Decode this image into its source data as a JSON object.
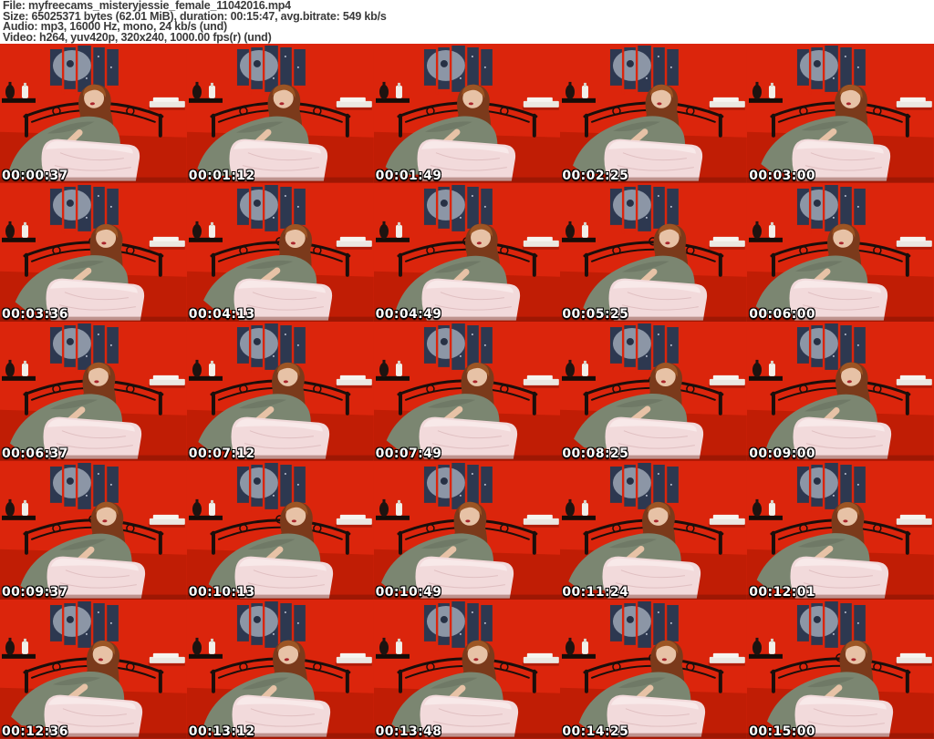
{
  "header": {
    "lines": [
      "File: myfreecams_misteryjessie_female_11042016.mp4",
      "Size: 65025371 bytes (62.01 MiB), duration: 00:15:47, avg.bitrate: 549 kb/s",
      "Audio: mp3, 16000 Hz, mono, 24 kb/s (und)",
      "Video: h264, yuv420p, 320x240, 1000.00 fps(r) (und)"
    ]
  },
  "grid": {
    "rows": 5,
    "cols": 5,
    "timestamps": [
      "00:00:37",
      "00:01:12",
      "00:01:49",
      "00:02:25",
      "00:03:00",
      "00:03:36",
      "00:04:13",
      "00:04:49",
      "00:05:25",
      "00:06:00",
      "00:06:37",
      "00:07:12",
      "00:07:49",
      "00:08:25",
      "00:09:00",
      "00:09:37",
      "00:10:13",
      "00:10:49",
      "00:11:24",
      "00:12:01",
      "00:12:36",
      "00:13:12",
      "00:13:48",
      "00:14:25",
      "00:15:00"
    ]
  },
  "colors": {
    "headertext": "#3a3a3a",
    "wall": "#db250c",
    "bed": "#c01d05",
    "art": "#2d3850",
    "mask": "#9aa3b2",
    "maskeye": "#263044",
    "headboard": "#1a0e0b",
    "shelf": "#150c08",
    "bottle": "#f1efe9",
    "towel": "#ebe8e2",
    "hair": "#7b3a1b",
    "hairhi": "#9c5524",
    "skin": "#e7c2a6",
    "dress": "#7b8671",
    "dressdark": "#66705d",
    "lips": "#a8242c",
    "pillow": "#f2dadb",
    "pillowhi": "#f8e9e9",
    "ts": "#ffffff"
  }
}
